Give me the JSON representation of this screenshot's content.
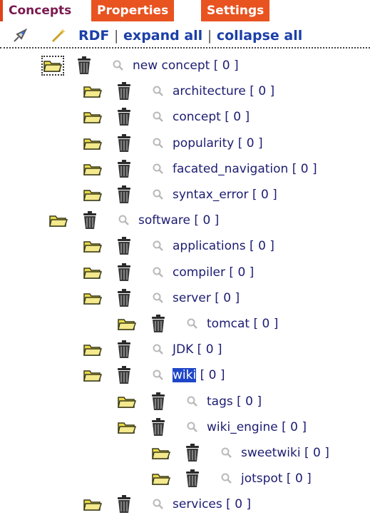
{
  "tabs": [
    {
      "label": "Concepts"
    },
    {
      "label": "Properties"
    },
    {
      "label": "Settings"
    }
  ],
  "toolbar": {
    "rdf": "RDF",
    "sep1": "|",
    "expand_all": "expand all",
    "sep2": "|",
    "collapse_all": "collapse all"
  },
  "tree": [
    {
      "name": "new concept",
      "count": "[ 0 ]",
      "depth": 0
    },
    {
      "name": "architecture",
      "count": "[ 0 ]",
      "depth": 1
    },
    {
      "name": "concept",
      "count": "[ 0 ]",
      "depth": 1
    },
    {
      "name": "popularity",
      "count": "[ 0 ]",
      "depth": 1
    },
    {
      "name": "facated_navigation",
      "count": "[ 0 ]",
      "depth": 1
    },
    {
      "name": "syntax_error",
      "count": "[ 0 ]",
      "depth": 1
    },
    {
      "name": "software",
      "count": "[ 0 ]",
      "depth": 0
    },
    {
      "name": "applications",
      "count": "[ 0 ]",
      "depth": 1
    },
    {
      "name": "compiler",
      "count": "[ 0 ]",
      "depth": 1
    },
    {
      "name": "server",
      "count": "[ 0 ]",
      "depth": 1
    },
    {
      "name": "tomcat",
      "count": "[ 0 ]",
      "depth": 2
    },
    {
      "name": "JDK",
      "count": "[ 0 ]",
      "depth": 1
    },
    {
      "name": "wiki",
      "count": "[ 0 ]",
      "depth": 1,
      "selected": true
    },
    {
      "name": "tags",
      "count": "[ 0 ]",
      "depth": 2
    },
    {
      "name": "wiki_engine",
      "count": "[ 0 ]",
      "depth": 2
    },
    {
      "name": "sweetwiki",
      "count": "[ 0 ]",
      "depth": 3
    },
    {
      "name": "jotspot",
      "count": "[ 0 ]",
      "depth": 3
    },
    {
      "name": "services",
      "count": "[ 0 ]",
      "depth": 1
    }
  ],
  "colors": {
    "folder": "#e8d94a",
    "trash": "#2b2b2b",
    "link": "#1b3fa8",
    "selection": "#1f46c8",
    "tab_active": "#e8531f"
  }
}
